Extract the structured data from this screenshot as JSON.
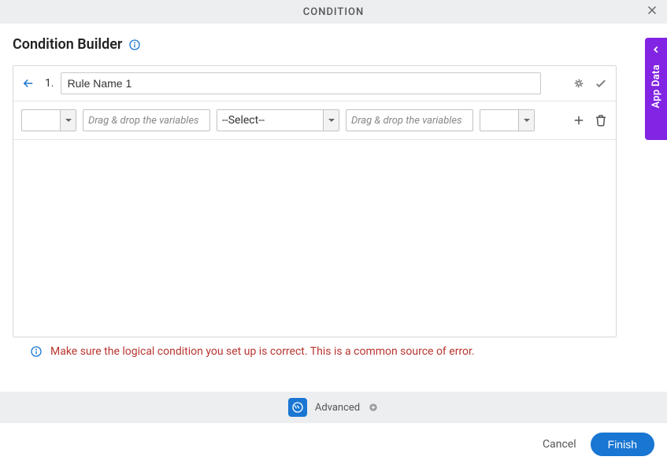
{
  "header": {
    "title": "CONDITION"
  },
  "title": "Condition Builder",
  "rule": {
    "number": "1.",
    "name": "Rule Name 1"
  },
  "row": {
    "left_placeholder": "Drag & drop the variables",
    "operator": "--Select--",
    "right_placeholder": "Drag & drop the variables"
  },
  "warning": "Make sure the logical condition you set up is correct. This is a common source of error.",
  "advanced": {
    "label": "Advanced"
  },
  "footer": {
    "cancel": "Cancel",
    "finish": "Finish"
  },
  "sidebar": {
    "label": "App Data"
  }
}
